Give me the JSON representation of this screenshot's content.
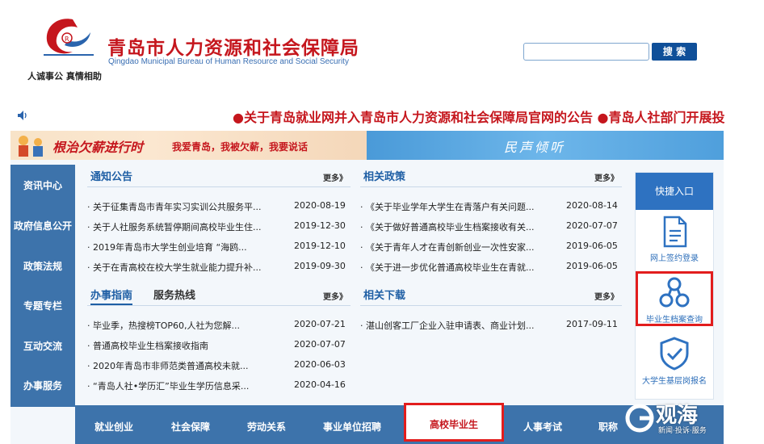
{
  "header": {
    "org_name_cn": "青岛市人力资源和社会保障局",
    "org_name_en": "Qingdao Municipal Bureau of Human Resource and Social Security",
    "slogan": "人诚事公 真情相助",
    "search_placeholder": "",
    "search_label": "搜 索"
  },
  "marquee": {
    "text": "●关于青岛就业网并入青岛市人力资源和社会保障局官网的公告  ●青岛人社部门开展投"
  },
  "banner": {
    "left_title": "根治欠薪进行时",
    "left_sub": "我爱青岛，我被欠薪，我要说话",
    "right_title": "民声倾听"
  },
  "left_nav": [
    "资讯中心",
    "政府信息公开",
    "政策法规",
    "专题专栏",
    "互动交流",
    "办事服务"
  ],
  "more_label": "更多》",
  "panels": {
    "notice": {
      "title": "通知公告",
      "rows": [
        {
          "text": "· 关于征集青岛市青年实习实训公共服务平...",
          "date": "2020-08-19"
        },
        {
          "text": "· 关于人社服务系统暂停期间高校毕业生住...",
          "date": "2019-12-30"
        },
        {
          "text": "· 2019年青岛市大学生创业培育 “海鸥...",
          "date": "2019-12-10"
        },
        {
          "text": "· 关于在青高校在校大学生就业能力提升补...",
          "date": "2019-09-30"
        }
      ]
    },
    "policy": {
      "title": "相关政策",
      "rows": [
        {
          "text": "· 《关于毕业学年大学生在青落户有关问题...",
          "date": "2020-08-14"
        },
        {
          "text": "· 《关于做好普通高校毕业生档案接收有关...",
          "date": "2020-07-07"
        },
        {
          "text": "· 《关于青年人才在青创新创业一次性安家...",
          "date": "2019-06-05"
        },
        {
          "text": "· 《关于进一步优化普通高校毕业生在青就...",
          "date": "2019-06-05"
        }
      ]
    },
    "guide": {
      "title": "办事指南",
      "title2": "服务热线",
      "rows": [
        {
          "text": "· 毕业季，热搜榜TOP60,人社为您解...",
          "date": "2020-07-21"
        },
        {
          "text": "· 普通高校毕业生档案接收指南",
          "date": "2020-07-07"
        },
        {
          "text": "· 2020年青岛市非师范类普通高校未就...",
          "date": "2020-06-03"
        },
        {
          "text": "· “青岛人社•学历汇”毕业生学历信息采...",
          "date": "2020-04-16"
        }
      ]
    },
    "download": {
      "title": "相关下载",
      "rows": [
        {
          "text": "· 湛山创客工厂企业入驻申请表、商业计划...",
          "date": "2017-09-11"
        }
      ]
    }
  },
  "quick": {
    "title": "快捷入口",
    "items": [
      {
        "label": "网上签约登录",
        "icon": "document-icon"
      },
      {
        "label": "毕业生档案查询",
        "icon": "network-icon"
      },
      {
        "label": "大学生基层岗报名",
        "icon": "shield-check-icon"
      }
    ]
  },
  "bottom_nav": [
    "就业创业",
    "社会保障",
    "劳动关系",
    "事业单位招聘",
    "高校毕业生",
    "人事考试",
    "职称"
  ],
  "watermark": {
    "text": "观海",
    "sub": "新闻·投诉·服务"
  },
  "colors": {
    "brand_red": "#c5161d",
    "nav_blue": "#3d73ab",
    "highlight_red": "#e21d1d"
  }
}
